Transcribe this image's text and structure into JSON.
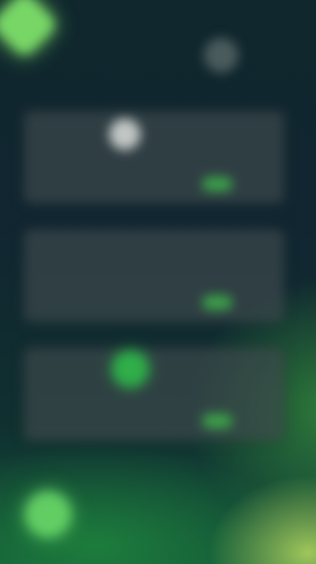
{
  "screen": {
    "note_text": "",
    "cards": [
      {
        "value": "",
        "caption": "",
        "badge": "",
        "icon": "avatar-icon"
      },
      {
        "value": "",
        "caption": "",
        "badge": "",
        "icon": ""
      },
      {
        "value": "",
        "caption": "",
        "badge": "",
        "icon": "status-dot-icon"
      }
    ]
  },
  "colors": {
    "background_top": "#10272d",
    "background_bottom_glow": "#a6cd5c",
    "accent_green": "#3da44a",
    "card_surface": "#3e4a4c",
    "highlight_green": "#7ee06a"
  }
}
